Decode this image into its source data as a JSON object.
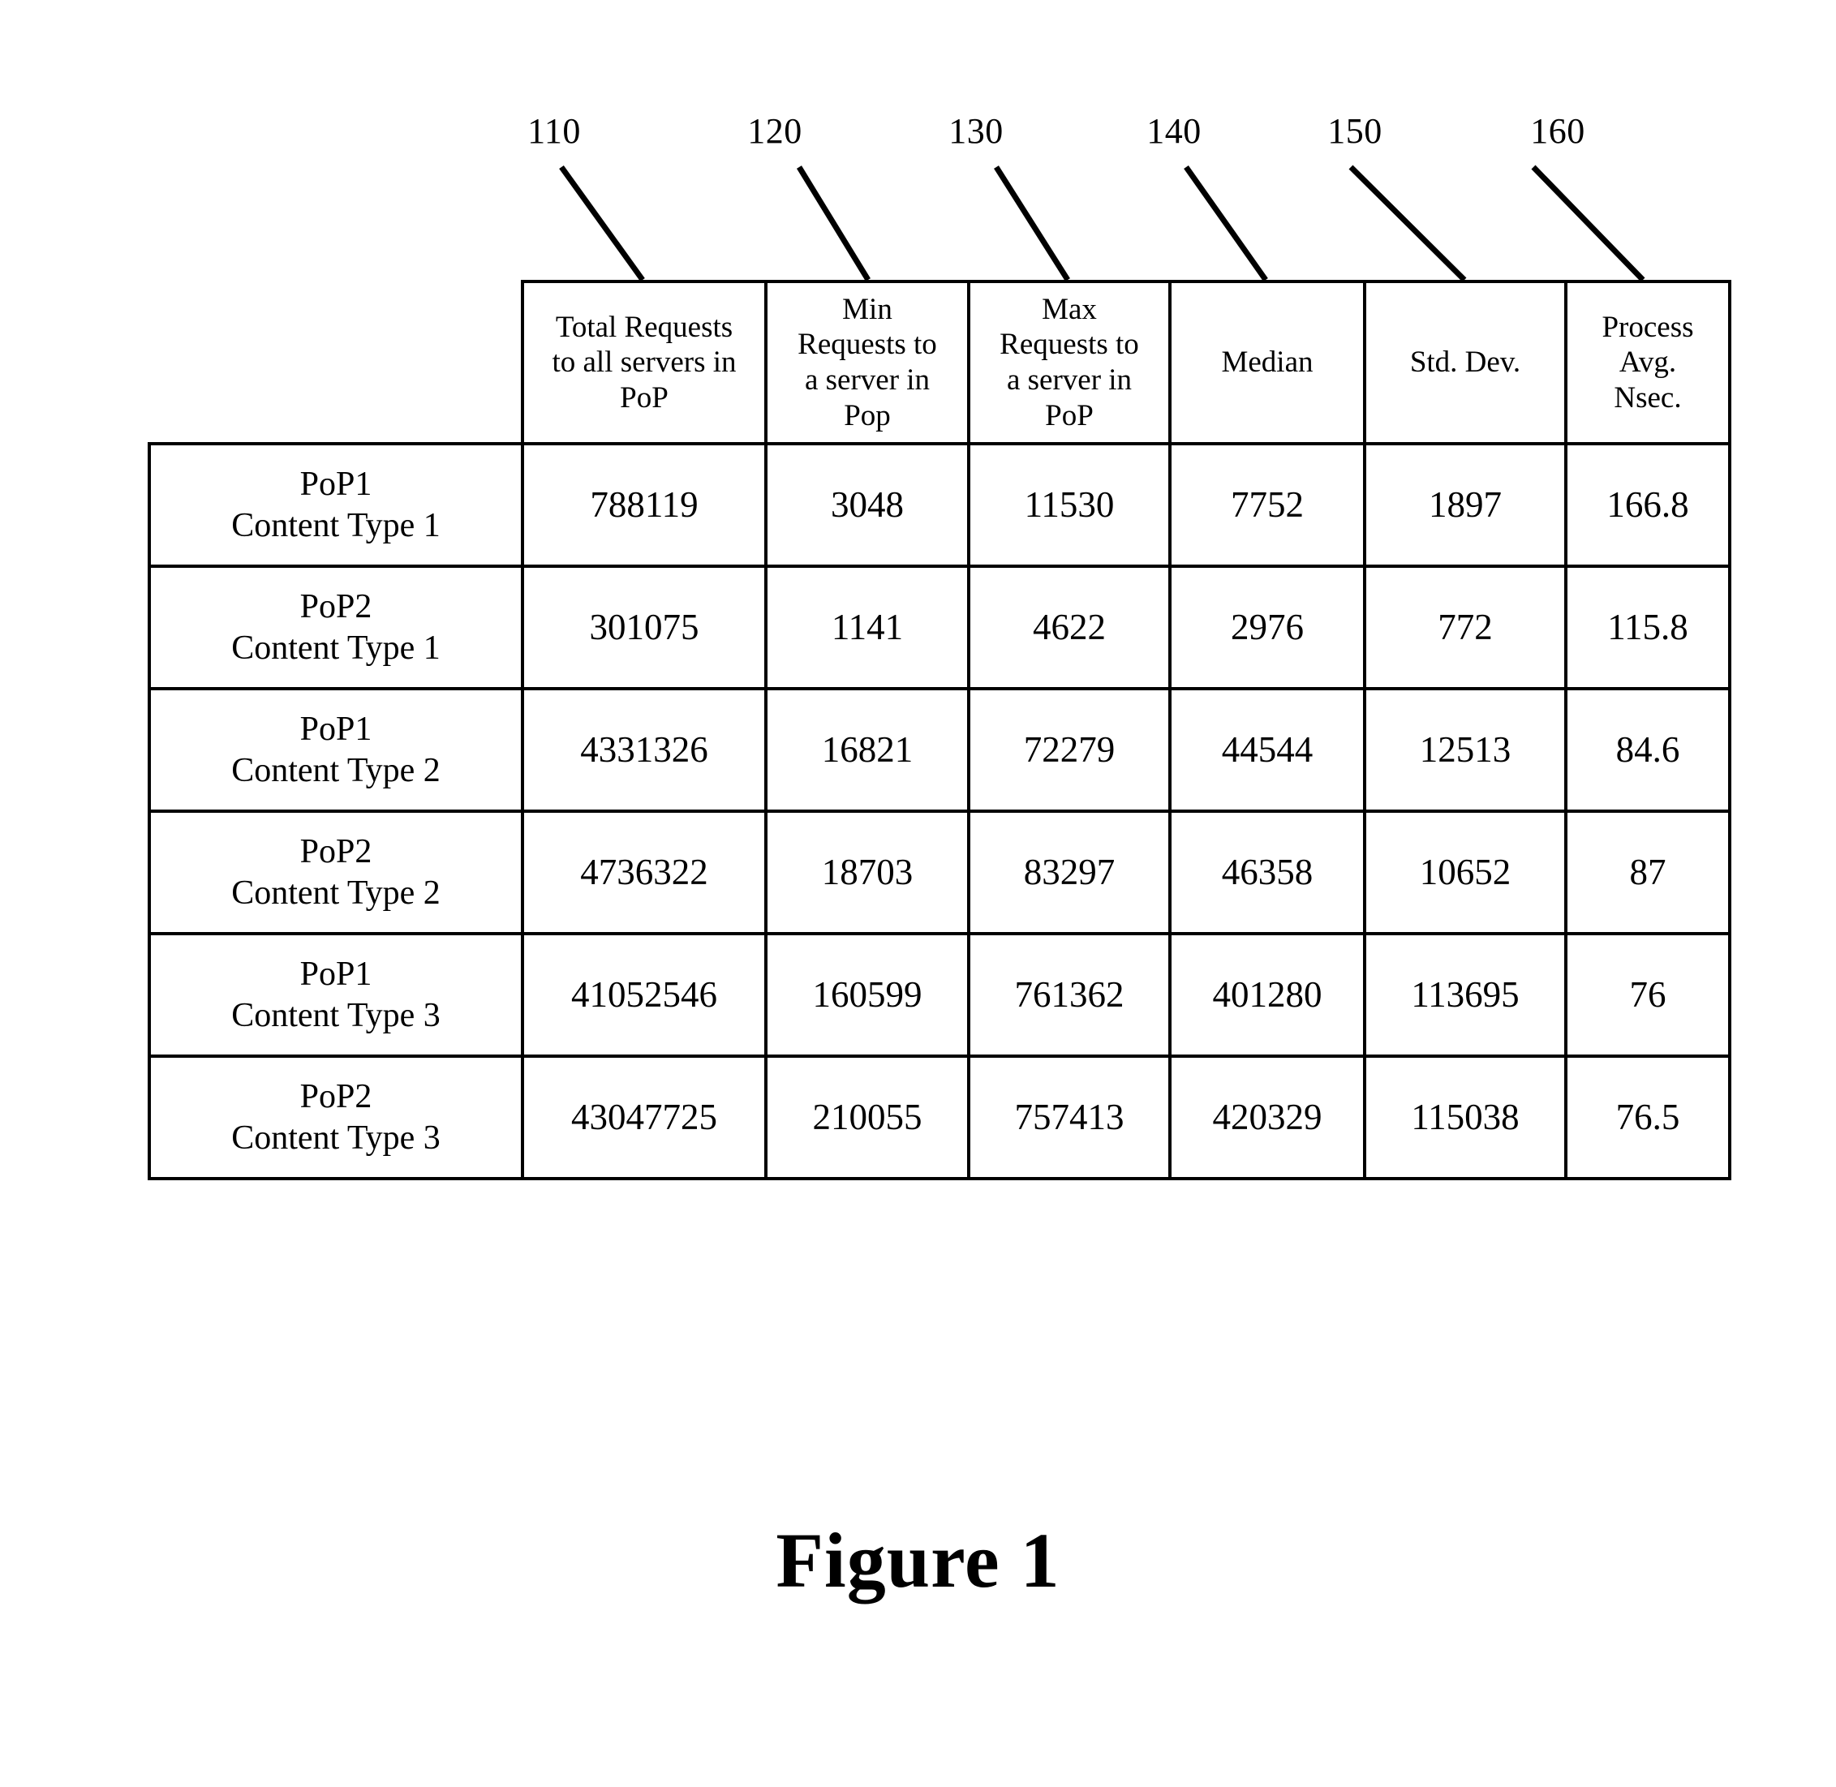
{
  "figure": {
    "caption": "Figure 1"
  },
  "callouts": [
    {
      "label": "110",
      "target_column": "Total Requests to all servers in PoP"
    },
    {
      "label": "120",
      "target_column": "Min Requests to a server in Pop"
    },
    {
      "label": "130",
      "target_column": "Max Requests to a server in PoP"
    },
    {
      "label": "140",
      "target_column": "Median"
    },
    {
      "label": "150",
      "target_column": "Std. Dev."
    },
    {
      "label": "160",
      "target_column": "Process Avg. Nsec."
    }
  ],
  "table": {
    "corner_label": "",
    "columns": [
      "Total Requests\nto all servers in\nPoP",
      "Min\nRequests to\na server in\nPop",
      "Max\nRequests to\na server in\nPoP",
      "Median",
      "Std. Dev.",
      "Process\nAvg.\nNsec."
    ],
    "rows": [
      {
        "label": "PoP1\nContent Type 1",
        "cells": [
          "788119",
          "3048",
          "11530",
          "7752",
          "1897",
          "166.8"
        ]
      },
      {
        "label": "PoP2\nContent Type 1",
        "cells": [
          "301075",
          "1141",
          "4622",
          "2976",
          "772",
          "115.8"
        ]
      },
      {
        "label": "PoP1\nContent Type 2",
        "cells": [
          "4331326",
          "16821",
          "72279",
          "44544",
          "12513",
          "84.6"
        ]
      },
      {
        "label": "PoP2\nContent Type 2",
        "cells": [
          "4736322",
          "18703",
          "83297",
          "46358",
          "10652",
          "87"
        ]
      },
      {
        "label": "PoP1\nContent Type 3",
        "cells": [
          "41052546",
          "160599",
          "761362",
          "401280",
          "113695",
          "76"
        ]
      },
      {
        "label": "PoP2\nContent Type 3",
        "cells": [
          "43047725",
          "210055",
          "757413",
          "420329",
          "115038",
          "76.5"
        ]
      }
    ]
  },
  "chart_data": {
    "type": "table",
    "title": "Figure 1",
    "columns": [
      "",
      "Total Requests to all servers in PoP",
      "Min Requests to a server in Pop",
      "Max Requests to a server in PoP",
      "Median",
      "Std. Dev.",
      "Process Avg. Nsec."
    ],
    "rows": [
      [
        "PoP1 Content Type 1",
        788119,
        3048,
        11530,
        7752,
        1897,
        166.8
      ],
      [
        "PoP2 Content Type 1",
        301075,
        1141,
        4622,
        2976,
        772,
        115.8
      ],
      [
        "PoP1 Content Type 2",
        4331326,
        16821,
        72279,
        44544,
        12513,
        84.6
      ],
      [
        "PoP2 Content Type 2",
        4736322,
        18703,
        83297,
        46358,
        10652,
        87
      ],
      [
        "PoP1 Content Type 3",
        41052546,
        160599,
        761362,
        401280,
        113695,
        76
      ],
      [
        "PoP2 Content Type 3",
        43047725,
        210055,
        757413,
        420329,
        115038,
        76.5
      ]
    ],
    "reference_numerals": [
      "110",
      "120",
      "130",
      "140",
      "150",
      "160"
    ]
  }
}
